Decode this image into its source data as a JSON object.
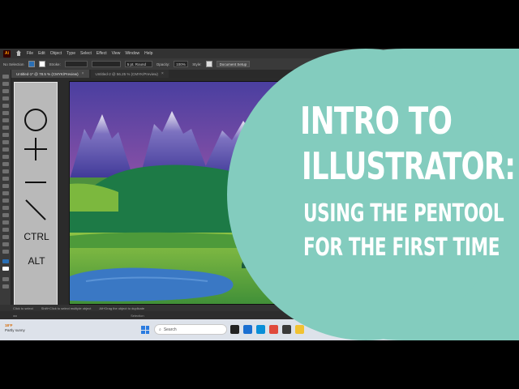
{
  "menubar": {
    "logo": "Ai",
    "items": [
      "File",
      "Edit",
      "Object",
      "Type",
      "Select",
      "Effect",
      "View",
      "Window",
      "Help"
    ]
  },
  "controlbar": {
    "selection_label": "No Selection",
    "stroke_label": "Stroke:",
    "brush": "5 pt. Round",
    "opacity_label": "Opacity:",
    "opacity_value": "100%",
    "style_label": "Style:",
    "document_setup": "Document Setup"
  },
  "tabs": [
    {
      "label": "Untitled-1* @ 78.5 % (CMYK/Preview)",
      "close": "×"
    },
    {
      "label": "Untitled-2 @ 56.25 % (CMYK/Preview)",
      "close": "×"
    }
  ],
  "keys": {
    "ctrl": "CTRL",
    "alt": "ALT"
  },
  "status": {
    "hint_1": "Click to select",
    "hint_2": "Shift+Click to select multiple object",
    "hint_3": "Alt+Drag the object to duplicate",
    "tool": "Selection"
  },
  "taskbar": {
    "temp": "18°F",
    "condition": "Partly sunny",
    "search_placeholder": "Search"
  },
  "title": {
    "line1": "INTRO TO",
    "line2": "ILLUSTRATOR:",
    "line3": "USING THE PENTOOL",
    "line4": "FOR THE FIRST TIME"
  },
  "colors": {
    "accent": "#83ccbe",
    "sky_top": "#4a3fa0",
    "sky_bottom": "#d8679a",
    "mountain": "#5a4ea8",
    "snow": "#e9e6f2",
    "hill_dark": "#1d7a46",
    "grass": "#5aa63b",
    "lake": "#3a78c4"
  }
}
